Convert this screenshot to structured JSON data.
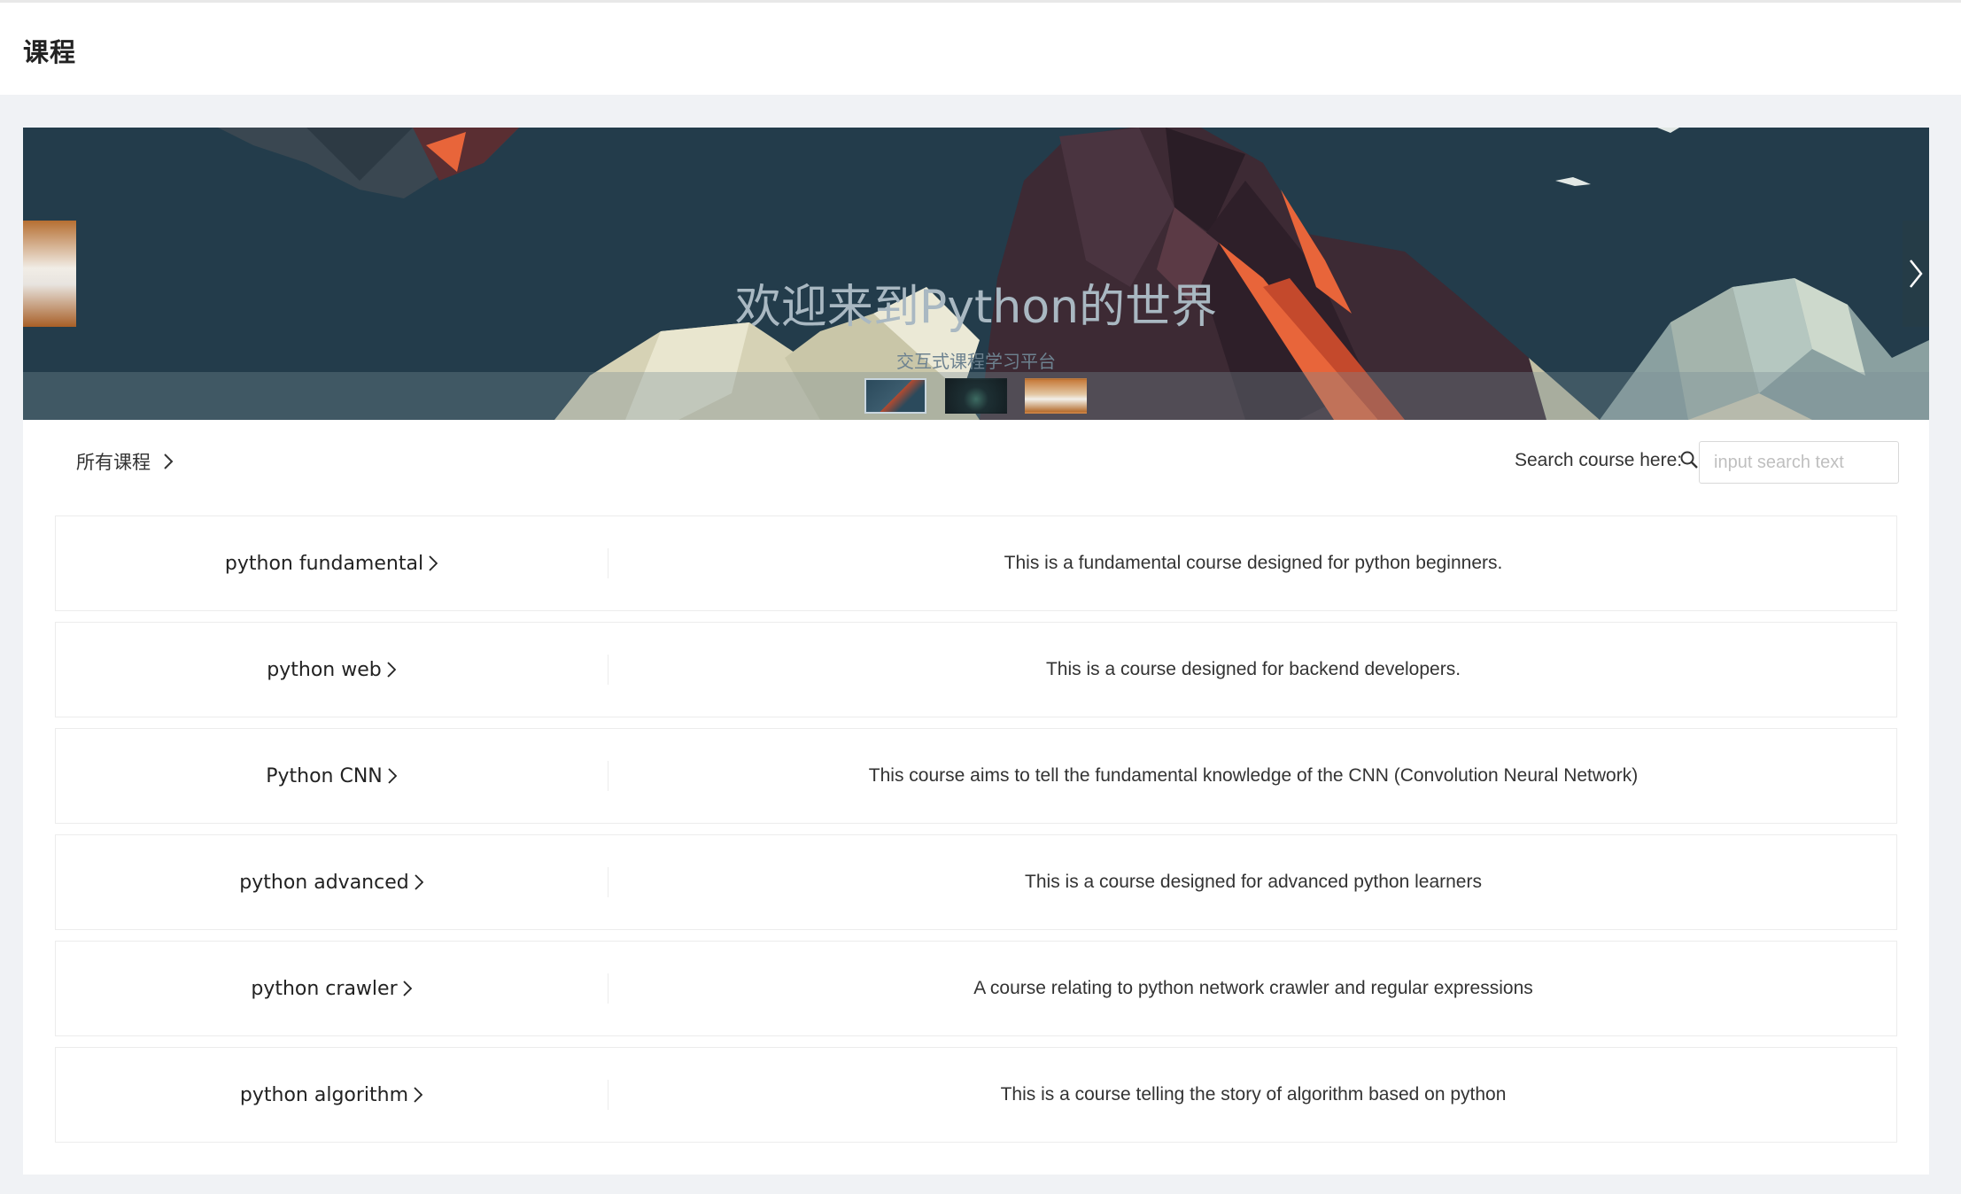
{
  "header": {
    "title": "课程"
  },
  "banner": {
    "title": "欢迎来到Python的世界",
    "subtitle": "交互式课程学习平台",
    "thumbnails": [
      "slide-1",
      "slide-2",
      "slide-3"
    ]
  },
  "toolbar": {
    "all_courses_label": "所有课程",
    "search_label": "Search course here:",
    "search_placeholder": "input search text",
    "search_value": ""
  },
  "courses": [
    {
      "name": "python fundamental",
      "description": "This is a fundamental course designed for python beginners."
    },
    {
      "name": "python web",
      "description": "This is a course designed for backend developers."
    },
    {
      "name": "Python CNN",
      "description": "This course aims to tell the fundamental knowledge of the CNN (Convolution Neural Network)"
    },
    {
      "name": "python advanced",
      "description": "This is a course designed for advanced python learners"
    },
    {
      "name": "python crawler",
      "description": "A course relating to python network crawler and regular expressions"
    },
    {
      "name": "python algorithm",
      "description": "This is a course telling the story of algorithm based on python"
    }
  ],
  "icons": {
    "chevron": "chevron-right-icon",
    "search": "search-icon"
  },
  "colors": {
    "banner_bg": "#233c4b",
    "page_bg": "#f0f2f5",
    "accent": "#e8653a"
  }
}
